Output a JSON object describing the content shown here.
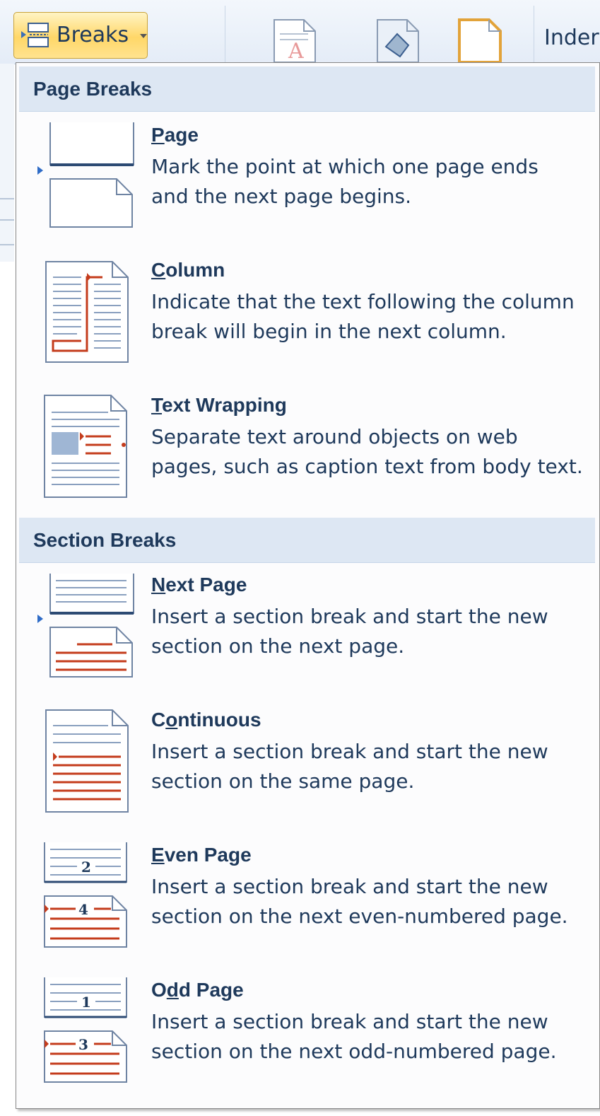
{
  "ribbon": {
    "breaks_label": "Breaks",
    "indent_label": "Inder"
  },
  "menu": {
    "page_breaks_header": "Page Breaks",
    "section_breaks_header": "Section Breaks",
    "items": [
      {
        "title_pre": "",
        "title_u": "P",
        "title_post": "age",
        "desc": "Mark the point at which one page ends\nand the next page begins.",
        "icon": "page-break-icon"
      },
      {
        "title_pre": "",
        "title_u": "C",
        "title_post": "olumn",
        "desc": "Indicate that the text following the column\nbreak will begin in the next column.",
        "icon": "column-break-icon"
      },
      {
        "title_pre": "",
        "title_u": "T",
        "title_post": "ext Wrapping",
        "desc": "Separate text around objects on web\npages, such as caption text from body text.",
        "icon": "text-wrapping-icon"
      },
      {
        "title_pre": "",
        "title_u": "N",
        "title_post": "ext Page",
        "desc": "Insert a section break and start the new\nsection on the next page.",
        "icon": "next-page-icon"
      },
      {
        "title_pre": "C",
        "title_u": "o",
        "title_post": "ntinuous",
        "desc": "Insert a section break and start the new\nsection on the same page.",
        "icon": "continuous-icon"
      },
      {
        "title_pre": "",
        "title_u": "E",
        "title_post": "ven Page",
        "desc": "Insert a section break and start the new\nsection on the next even-numbered page.",
        "icon": "even-page-icon"
      },
      {
        "title_pre": "O",
        "title_u": "d",
        "title_post": "d Page",
        "desc": "Insert a section break and start the new\nsection on the next odd-numbered page.",
        "icon": "odd-page-icon"
      }
    ]
  },
  "icons": {
    "even_top_number": "2",
    "even_bottom_number": "4",
    "odd_top_number": "1",
    "odd_bottom_number": "3"
  },
  "colors": {
    "accent_red": "#c43c1c",
    "header_bg": "#dde7f3",
    "button_highlight": "#ffd768",
    "text": "#1e395b"
  }
}
